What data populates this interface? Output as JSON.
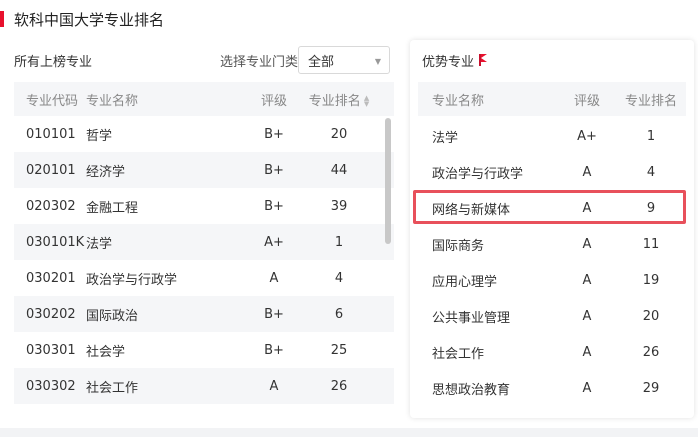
{
  "page": {
    "title": "软科中国大学专业排名",
    "accent_color": "#e8112d"
  },
  "left": {
    "title": "所有上榜专业",
    "filter_label": "选择专业门类",
    "filter_value": "全部",
    "columns": {
      "code": "专业代码",
      "name": "专业名称",
      "grade": "评级",
      "rank": "专业排名"
    },
    "rows": [
      {
        "code": "010101",
        "name": "哲学",
        "grade": "B+",
        "rank": "20"
      },
      {
        "code": "020101",
        "name": "经济学",
        "grade": "B+",
        "rank": "44"
      },
      {
        "code": "020302",
        "name": "金融工程",
        "grade": "B+",
        "rank": "39"
      },
      {
        "code": "030101K",
        "name": "法学",
        "grade": "A+",
        "rank": "1"
      },
      {
        "code": "030201",
        "name": "政治学与行政学",
        "grade": "A",
        "rank": "4"
      },
      {
        "code": "030202",
        "name": "国际政治",
        "grade": "B+",
        "rank": "6"
      },
      {
        "code": "030301",
        "name": "社会学",
        "grade": "B+",
        "rank": "25"
      },
      {
        "code": "030302",
        "name": "社会工作",
        "grade": "A",
        "rank": "26"
      }
    ]
  },
  "right": {
    "title": "优势专业",
    "columns": {
      "name": "专业名称",
      "grade": "评级",
      "rank": "专业排名"
    },
    "rows": [
      {
        "name": "法学",
        "grade": "A+",
        "rank": "1"
      },
      {
        "name": "政治学与行政学",
        "grade": "A",
        "rank": "4"
      },
      {
        "name": "网络与新媒体",
        "grade": "A",
        "rank": "9"
      },
      {
        "name": "国际商务",
        "grade": "A",
        "rank": "11"
      },
      {
        "name": "应用心理学",
        "grade": "A",
        "rank": "19"
      },
      {
        "name": "公共事业管理",
        "grade": "A",
        "rank": "20"
      },
      {
        "name": "社会工作",
        "grade": "A",
        "rank": "26"
      },
      {
        "name": "思想政治教育",
        "grade": "A",
        "rank": "29"
      }
    ]
  }
}
